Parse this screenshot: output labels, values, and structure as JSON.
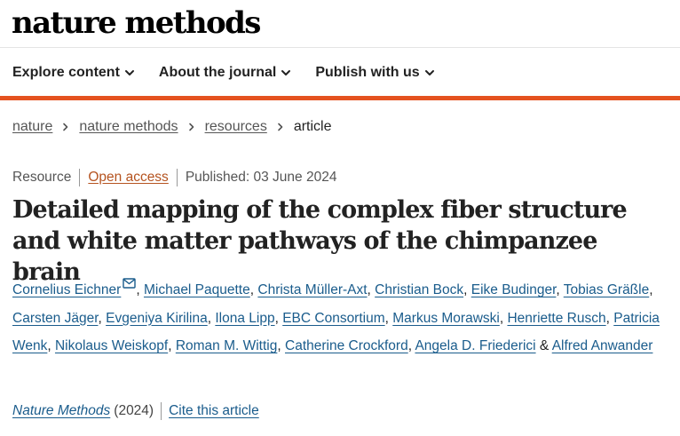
{
  "site": {
    "brand": "nature methods"
  },
  "nav": {
    "items": [
      {
        "label": "Explore content"
      },
      {
        "label": "About the journal"
      },
      {
        "label": "Publish with us"
      }
    ]
  },
  "breadcrumb": {
    "items": [
      "nature",
      "nature methods",
      "resources"
    ],
    "current": "article"
  },
  "article": {
    "type": "Resource",
    "access": "Open access",
    "published": "Published: 03 June 2024",
    "title": "Detailed mapping of the complex fiber structure and white matter pathways of the chimpanzee brain",
    "authors": [
      "Cornelius Eichner",
      "Michael Paquette",
      "Christa Müller-Axt",
      "Christian Bock",
      "Eike Budinger",
      "Tobias Gräßle",
      "Carsten Jäger",
      "Evgeniya Kirilina",
      "Ilona Lipp",
      "EBC Consortium",
      "Markus Morawski",
      "Henriette Rusch",
      "Patricia Wenk",
      "Nikolaus Weiskopf",
      "Roman M. Wittig",
      "Catherine Crockford",
      "Angela D. Friederici",
      "Alfred Anwander"
    ],
    "author_separator": ", ",
    "author_last_joiner": " & ",
    "journal": "Nature Methods",
    "year": "(2024)",
    "cite_label": "Cite this article"
  },
  "colors": {
    "accent_bar": "#e5521f",
    "link": "#1a5c8c",
    "open_access": "#b5531f"
  },
  "icons": {
    "nav_chevron": "chevron-down-icon",
    "breadcrumb_separator": "chevron-right-icon",
    "corresponding_author": "mail-icon"
  }
}
